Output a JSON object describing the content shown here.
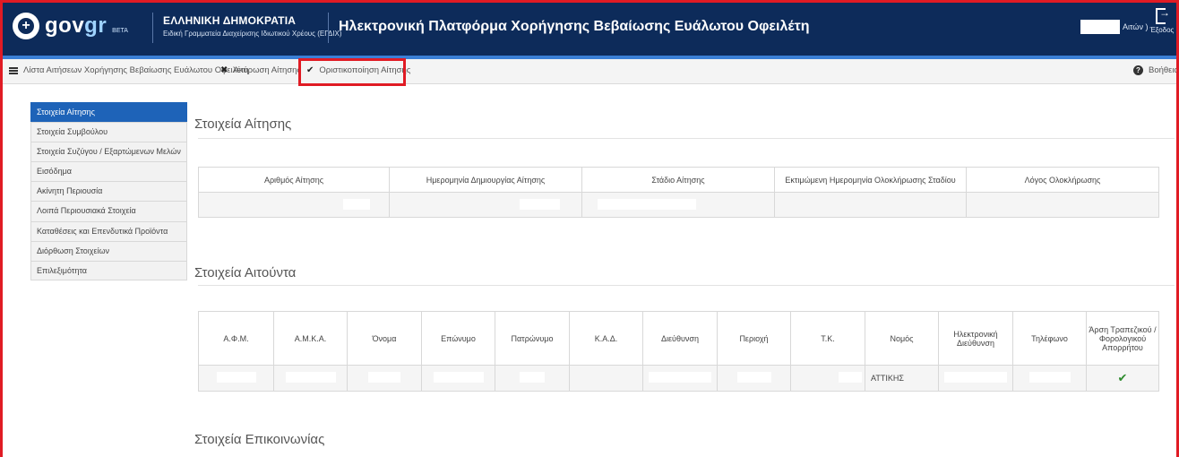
{
  "header": {
    "logo_text_gov": "gov",
    "logo_text_gr": "gr",
    "logo_beta": "BETA",
    "org_title": "ΕΛΛΗΝΙΚΗ ΔΗΜΟΚΡΑΤΙΑ",
    "org_subtitle": "Ειδική Γραμματεία Διαχείρισης Ιδιωτικού Χρέους (ΕΓΔΙΧ)",
    "platform_title": "Ηλεκτρονική Πλατφόρμα Χορήγησης Βεβαίωσης Ευάλωτου Οφειλέτη",
    "user_suffix": "Αιτών )",
    "exit_label": "Έξοδος"
  },
  "toolbar": {
    "list_label": "Λίστα Αιτήσεων Χορήγησης Βεβαίωσης Ευάλωτου Οφειλέτη",
    "cancel_label": "Ακύρωση Αίτησης",
    "finalize_label": "Οριστικοποίηση Αίτησης",
    "help_label": "Βοήθεια"
  },
  "sidebar": {
    "items": [
      {
        "label": "Στοιχεία Αίτησης",
        "active": true
      },
      {
        "label": "Στοιχεία Συμβούλου"
      },
      {
        "label": "Στοιχεία Συζύγου / Εξαρτώμενων Μελών"
      },
      {
        "label": "Εισόδημα"
      },
      {
        "label": "Ακίνητη Περιουσία"
      },
      {
        "label": "Λοιπά Περιουσιακά Στοιχεία"
      },
      {
        "label": "Καταθέσεις και Επενδυτικά Προϊόντα"
      },
      {
        "label": "Διόρθωση Στοιχείων"
      },
      {
        "label": "Επιλεξιμότητα"
      }
    ]
  },
  "application": {
    "title": "Στοιχεία Αίτησης",
    "columns": [
      "Αριθμός Αίτησης",
      "Ημερομηνία Δημιουργίας Αίτησης",
      "Στάδιο Αίτησης",
      "Εκτιμώμενη Ημερομηνία Ολοκλήρωσης Σταδίου",
      "Λόγος Ολοκλήρωσης"
    ]
  },
  "applicant": {
    "title": "Στοιχεία Αιτούντα",
    "columns": [
      "Α.Φ.Μ.",
      "Α.Μ.Κ.Α.",
      "Όνομα",
      "Επώνυμο",
      "Πατρώνυμο",
      "Κ.Α.Δ.",
      "Διεύθυνση",
      "Περιοχή",
      "Τ.Κ.",
      "Νομός",
      "Ηλεκτρονική Διεύθυνση",
      "Τηλέφωνο",
      "Άρση Τραπεζικού / Φορολογικού Απορρήτου"
    ],
    "nomos_value": "ΑΤΤΙΚΗΣ",
    "waiver_icon": "check-icon"
  },
  "contact": {
    "title": "Στοιχεία Επικοινωνίας"
  }
}
